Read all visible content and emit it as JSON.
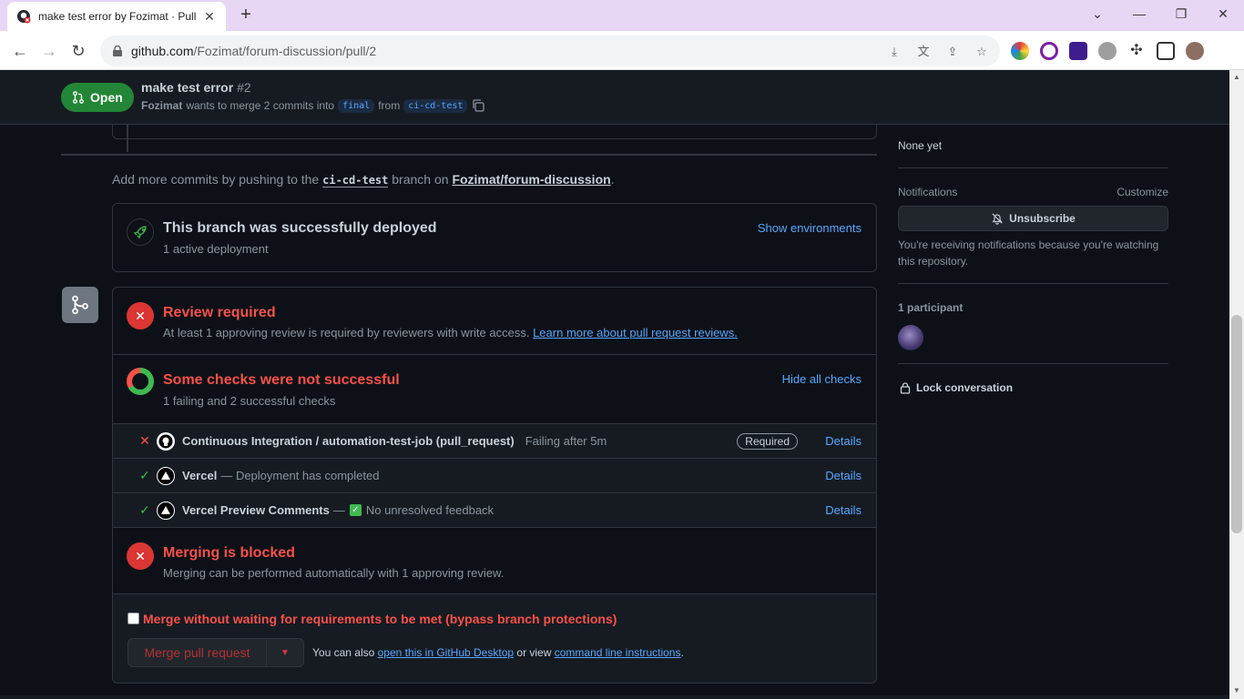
{
  "browser": {
    "tab_title": "make test error by Fozimat · Pull",
    "tab_close": "✕",
    "new_tab": "+",
    "url_host": "github.com",
    "url_path": "/Fozimat/forum-discussion/pull/2",
    "window_controls": [
      "⌄",
      "—",
      "❐",
      "✕"
    ]
  },
  "pr": {
    "state": "Open",
    "title": "make test error",
    "number": "#2",
    "author": "Fozimat",
    "sub_text": "wants to merge 2 commits into",
    "base_branch": "final",
    "from_text": "from",
    "head_branch": "ci-cd-test"
  },
  "push_note": {
    "prefix": "Add more commits by pushing to the",
    "branch": "ci-cd-test",
    "middle": "branch on",
    "repo": "Fozimat/forum-discussion",
    "suffix": "."
  },
  "deploy": {
    "title": "This branch was successfully deployed",
    "subtitle": "1 active deployment",
    "link": "Show environments"
  },
  "review": {
    "title": "Review required",
    "desc": "At least 1 approving review is required by reviewers with write access.",
    "link": "Learn more about pull request reviews."
  },
  "checks": {
    "title": "Some checks were not successful",
    "subtitle": "1 failing and 2 successful checks",
    "toggle": "Hide all checks",
    "items": [
      {
        "status": "✕",
        "name": "Continuous Integration / automation-test-job (pull_request)",
        "desc": "Failing after 5m",
        "badge": "Required",
        "link": "Details"
      },
      {
        "status": "✓",
        "name": "Vercel",
        "desc": "— Deployment has completed",
        "link": "Details"
      },
      {
        "status": "✓",
        "name": "Vercel Preview Comments",
        "desc_prefix": "—",
        "desc": "No unresolved feedback",
        "link": "Details"
      }
    ]
  },
  "blocked": {
    "title": "Merging is blocked",
    "desc": "Merging can be performed automatically with 1 approving review."
  },
  "merge": {
    "bypass_label": "Merge without waiting for requirements to be met (bypass branch protections)",
    "button": "Merge pull request",
    "also_prefix": "You can also",
    "desktop_link": "open this in GitHub Desktop",
    "or_view": "or view",
    "cli_link": "command line instructions",
    "suffix": "."
  },
  "sidebar": {
    "milestone_value": "None yet",
    "notifications_heading": "Notifications",
    "customize": "Customize",
    "unsubscribe": "Unsubscribe",
    "notifications_note": "You're receiving notifications because you're watching this repository.",
    "participants": "1 participant",
    "lock": "Lock conversation"
  },
  "colors": {
    "open_green": "#238636",
    "danger": "#f85149",
    "link": "#58a6ff",
    "bg": "#0d1117"
  }
}
